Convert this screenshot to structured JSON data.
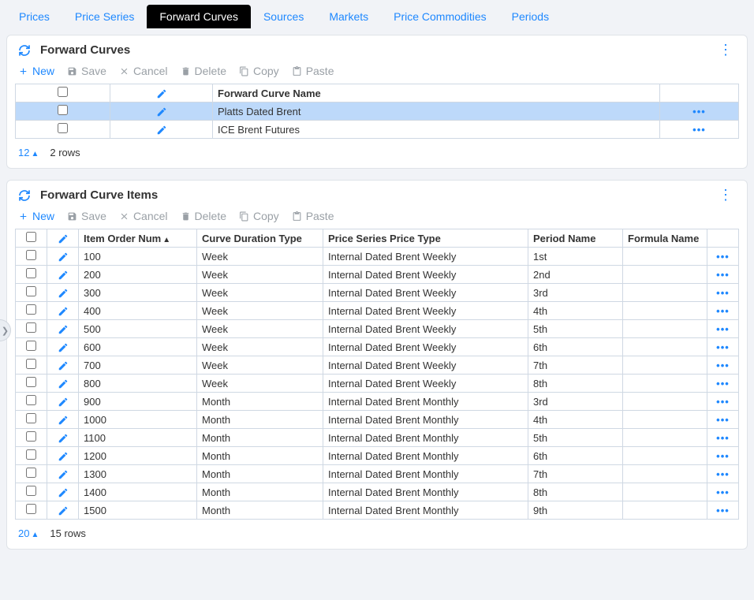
{
  "tabs": [
    {
      "label": "Prices",
      "active": false
    },
    {
      "label": "Price Series",
      "active": false
    },
    {
      "label": "Forward Curves",
      "active": true
    },
    {
      "label": "Sources",
      "active": false
    },
    {
      "label": "Markets",
      "active": false
    },
    {
      "label": "Price Commodities",
      "active": false
    },
    {
      "label": "Periods",
      "active": false
    }
  ],
  "toolbar": {
    "new": "New",
    "save": "Save",
    "cancel": "Cancel",
    "delete": "Delete",
    "copy": "Copy",
    "paste": "Paste"
  },
  "curves_panel": {
    "title": "Forward Curves",
    "header_name": "Forward Curve Name",
    "rows": [
      {
        "name": "Platts Dated Brent",
        "selected": true
      },
      {
        "name": "ICE Brent Futures",
        "selected": false
      }
    ],
    "page_size": "12",
    "row_count": "2 rows"
  },
  "items_panel": {
    "title": "Forward Curve Items",
    "headers": {
      "order": "Item Order Num",
      "duration": "Curve Duration Type",
      "series": "Price Series Price Type",
      "period": "Period Name",
      "formula": "Formula Name"
    },
    "rows": [
      {
        "order": "100",
        "duration": "Week",
        "series": "Internal Dated Brent Weekly",
        "period": "1st",
        "formula": ""
      },
      {
        "order": "200",
        "duration": "Week",
        "series": "Internal Dated Brent Weekly",
        "period": "2nd",
        "formula": ""
      },
      {
        "order": "300",
        "duration": "Week",
        "series": "Internal Dated Brent Weekly",
        "period": "3rd",
        "formula": ""
      },
      {
        "order": "400",
        "duration": "Week",
        "series": "Internal Dated Brent Weekly",
        "period": "4th",
        "formula": ""
      },
      {
        "order": "500",
        "duration": "Week",
        "series": "Internal Dated Brent Weekly",
        "period": "5th",
        "formula": ""
      },
      {
        "order": "600",
        "duration": "Week",
        "series": "Internal Dated Brent Weekly",
        "period": "6th",
        "formula": ""
      },
      {
        "order": "700",
        "duration": "Week",
        "series": "Internal Dated Brent Weekly",
        "period": "7th",
        "formula": ""
      },
      {
        "order": "800",
        "duration": "Week",
        "series": "Internal Dated Brent Weekly",
        "period": "8th",
        "formula": ""
      },
      {
        "order": "900",
        "duration": "Month",
        "series": "Internal Dated Brent Monthly",
        "period": "3rd",
        "formula": ""
      },
      {
        "order": "1000",
        "duration": "Month",
        "series": "Internal Dated Brent Monthly",
        "period": "4th",
        "formula": ""
      },
      {
        "order": "1100",
        "duration": "Month",
        "series": "Internal Dated Brent Monthly",
        "period": "5th",
        "formula": ""
      },
      {
        "order": "1200",
        "duration": "Month",
        "series": "Internal Dated Brent Monthly",
        "period": "6th",
        "formula": ""
      },
      {
        "order": "1300",
        "duration": "Month",
        "series": "Internal Dated Brent Monthly",
        "period": "7th",
        "formula": ""
      },
      {
        "order": "1400",
        "duration": "Month",
        "series": "Internal Dated Brent Monthly",
        "period": "8th",
        "formula": ""
      },
      {
        "order": "1500",
        "duration": "Month",
        "series": "Internal Dated Brent Monthly",
        "period": "9th",
        "formula": ""
      }
    ],
    "page_size": "20",
    "row_count": "15 rows"
  }
}
